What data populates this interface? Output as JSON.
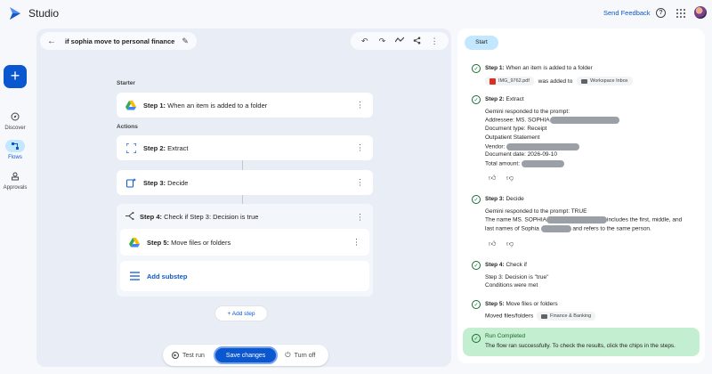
{
  "app": {
    "title": "Studio"
  },
  "header": {
    "send_feedback": "Send Feedback",
    "help_icon": "help-icon",
    "apps_icon": "apps-icon",
    "avatar": "avatar"
  },
  "rail": {
    "create_label": "+",
    "items": [
      {
        "label": "Discover",
        "icon": "compass-icon",
        "active": false
      },
      {
        "label": "Flows",
        "icon": "flows-icon",
        "active": true
      },
      {
        "label": "Approvals",
        "icon": "approvals-icon",
        "active": false
      }
    ]
  },
  "flow": {
    "title": "if sophia move to personal finance",
    "starter_label": "Starter",
    "actions_label": "Actions",
    "step1": {
      "prefix": "Step 1:",
      "text": "When an item is added to a folder"
    },
    "step2": {
      "prefix": "Step 2:",
      "text": "Extract"
    },
    "step3": {
      "prefix": "Step 3:",
      "text": "Decide"
    },
    "step4": {
      "prefix": "Step 4:",
      "text": "Check if Step 3: Decision is true"
    },
    "step5": {
      "prefix": "Step 5:",
      "text": "Move files or folders"
    },
    "add_substep": "Add substep",
    "add_step": "+ Add step"
  },
  "bottom_bar": {
    "test_run": "Test run",
    "save_changes": "Save changes",
    "turn_off": "Turn off"
  },
  "run_panel": {
    "start": "Start",
    "s1": {
      "title": "Step 1:",
      "text": "When an item is added to a folder",
      "file_chip": "IMG_9762.pdf",
      "was_added": "was added to",
      "folder_chip": "Workspace Inbox"
    },
    "s2": {
      "title": "Step 2:",
      "text": "Extract",
      "lines": [
        "Gemini responded to the prompt:",
        "Addressee: MS. SOPHIA",
        "Document type: Receipt",
        "Outpatient Statement",
        "Vendor:",
        "Document date: 2026-09-10",
        "Total amount:"
      ]
    },
    "s3": {
      "title": "Step 3:",
      "text": "Decide",
      "line1": "Gemini responded to the prompt: TRUE",
      "line2a": "The name MS. SOPHIA",
      "line2b": "includes the first, middle, and",
      "line3a": "last names of Sophia",
      "line3b": "and refers to the same person."
    },
    "s4": {
      "title": "Step 4:",
      "text": "Check if",
      "line1": "Step 3: Decision is \"true\"",
      "line2": "Conditions were met"
    },
    "s5": {
      "title": "Step 5:",
      "text": "Move files or folders",
      "moved": "Moved files/folders",
      "chip": "Finance & Banking"
    },
    "completed": {
      "title": "Run Completed",
      "text": "The flow ran successfully. To check the results, click the chips in the steps."
    }
  },
  "colors": {
    "accent": "#0b57d0",
    "success": "#146c2e",
    "success_bg": "#c4eed0",
    "canvas_bg": "#e9eef6"
  }
}
